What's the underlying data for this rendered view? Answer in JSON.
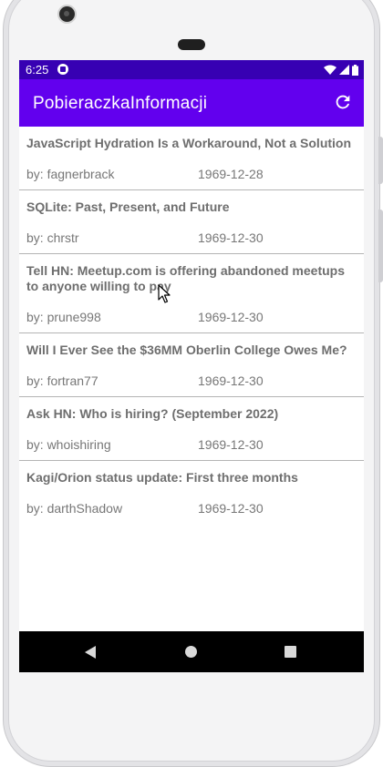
{
  "status_bar": {
    "time": "6:25",
    "app_icon": "app-notification-icon",
    "icons": [
      "wifi-icon",
      "signal-icon",
      "battery-icon"
    ]
  },
  "app_bar": {
    "title": "PobieraczkaInformacji",
    "refresh_icon": "refresh-icon"
  },
  "articles": [
    {
      "title": "JavaScript Hydration Is a Workaround, Not a Solution",
      "author": "by: fagnerbrack",
      "date": "1969-12-28"
    },
    {
      "title": "SQLite: Past, Present, and Future",
      "author": "by: chrstr",
      "date": "1969-12-30"
    },
    {
      "title": "Tell HN: Meetup.com is offering abandoned meetups to anyone willing to pay",
      "author": "by: prune998",
      "date": "1969-12-30"
    },
    {
      "title": "Will I Ever See the $36MM Oberlin College Owes Me?",
      "author": "by: fortran77",
      "date": "1969-12-30"
    },
    {
      "title": "Ask HN: Who is hiring? (September 2022)",
      "author": "by: whoishiring",
      "date": "1969-12-30"
    },
    {
      "title": "Kagi/Orion status update: First three months",
      "author": "by: darthShadow",
      "date": "1969-12-30"
    }
  ],
  "nav_bar": {
    "back": "back-icon",
    "home": "home-icon",
    "recents": "recents-icon"
  },
  "colors": {
    "status_bar": "#3700b3",
    "app_bar": "#6200ee",
    "title_text": "#6e6e6e",
    "meta_text": "#777777"
  }
}
